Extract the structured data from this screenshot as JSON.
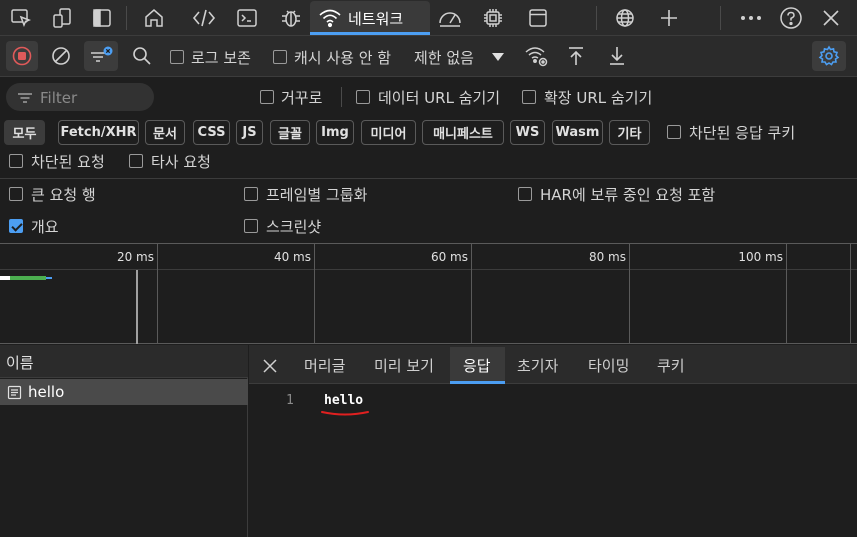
{
  "colors": {
    "accent": "#4c9ef2",
    "record": "#e05a5a",
    "annotation_underline": "#e02020",
    "waterfall_bar": "#4caf50"
  },
  "tabbar": {
    "network_tab_label": "네트워크",
    "icons": [
      "inspect-icon",
      "device-emulation-icon",
      "panel-toggle-icon",
      "welcome-home-icon",
      "elements-icon",
      "console-icon",
      "sources-bug-icon",
      "network-wifi-icon",
      "performance-gauge-icon",
      "memory-chip-icon",
      "application-window-icon",
      "security-globe-icon",
      "add-tool-icon",
      "more-icon",
      "help-icon",
      "close-icon"
    ]
  },
  "toolbar": {
    "preserve_log": "로그 보존",
    "disable_cache": "캐시 사용 안 함",
    "throttling": "제한 없음"
  },
  "filter": {
    "placeholder": "Filter",
    "invert": "거꾸로",
    "hide_data_urls": "데이터 URL 숨기기",
    "hide_extension_urls": "확장 URL 숨기기"
  },
  "type_filters": [
    "모두",
    "Fetch/XHR",
    "문서",
    "CSS",
    "JS",
    "글꼴",
    "Img",
    "미디어",
    "매니페스트",
    "WS",
    "Wasm",
    "기타"
  ],
  "blocked_response_cookies": "차단된 응답 쿠키",
  "blocked_requests": "차단된 요청",
  "third_party_requests": "타사 요청",
  "settings": {
    "big_request_rows": "큰 요청 행",
    "group_by_frame": "프레임별 그룹화",
    "har_pending": "HAR에 보류 중인 요청 포함",
    "overview": "개요",
    "screenshots": "스크린샷"
  },
  "timeline": {
    "ticks": [
      "20 ms",
      "40 ms",
      "60 ms",
      "80 ms",
      "100 ms"
    ]
  },
  "requests": {
    "name_header": "이름",
    "rows": [
      "hello"
    ]
  },
  "detail": {
    "tabs": [
      "머리글",
      "미리 보기",
      "응답",
      "초기자",
      "타이밍",
      "쿠키"
    ],
    "active_tab": "응답",
    "line_number": "1",
    "response_body": "hello"
  }
}
